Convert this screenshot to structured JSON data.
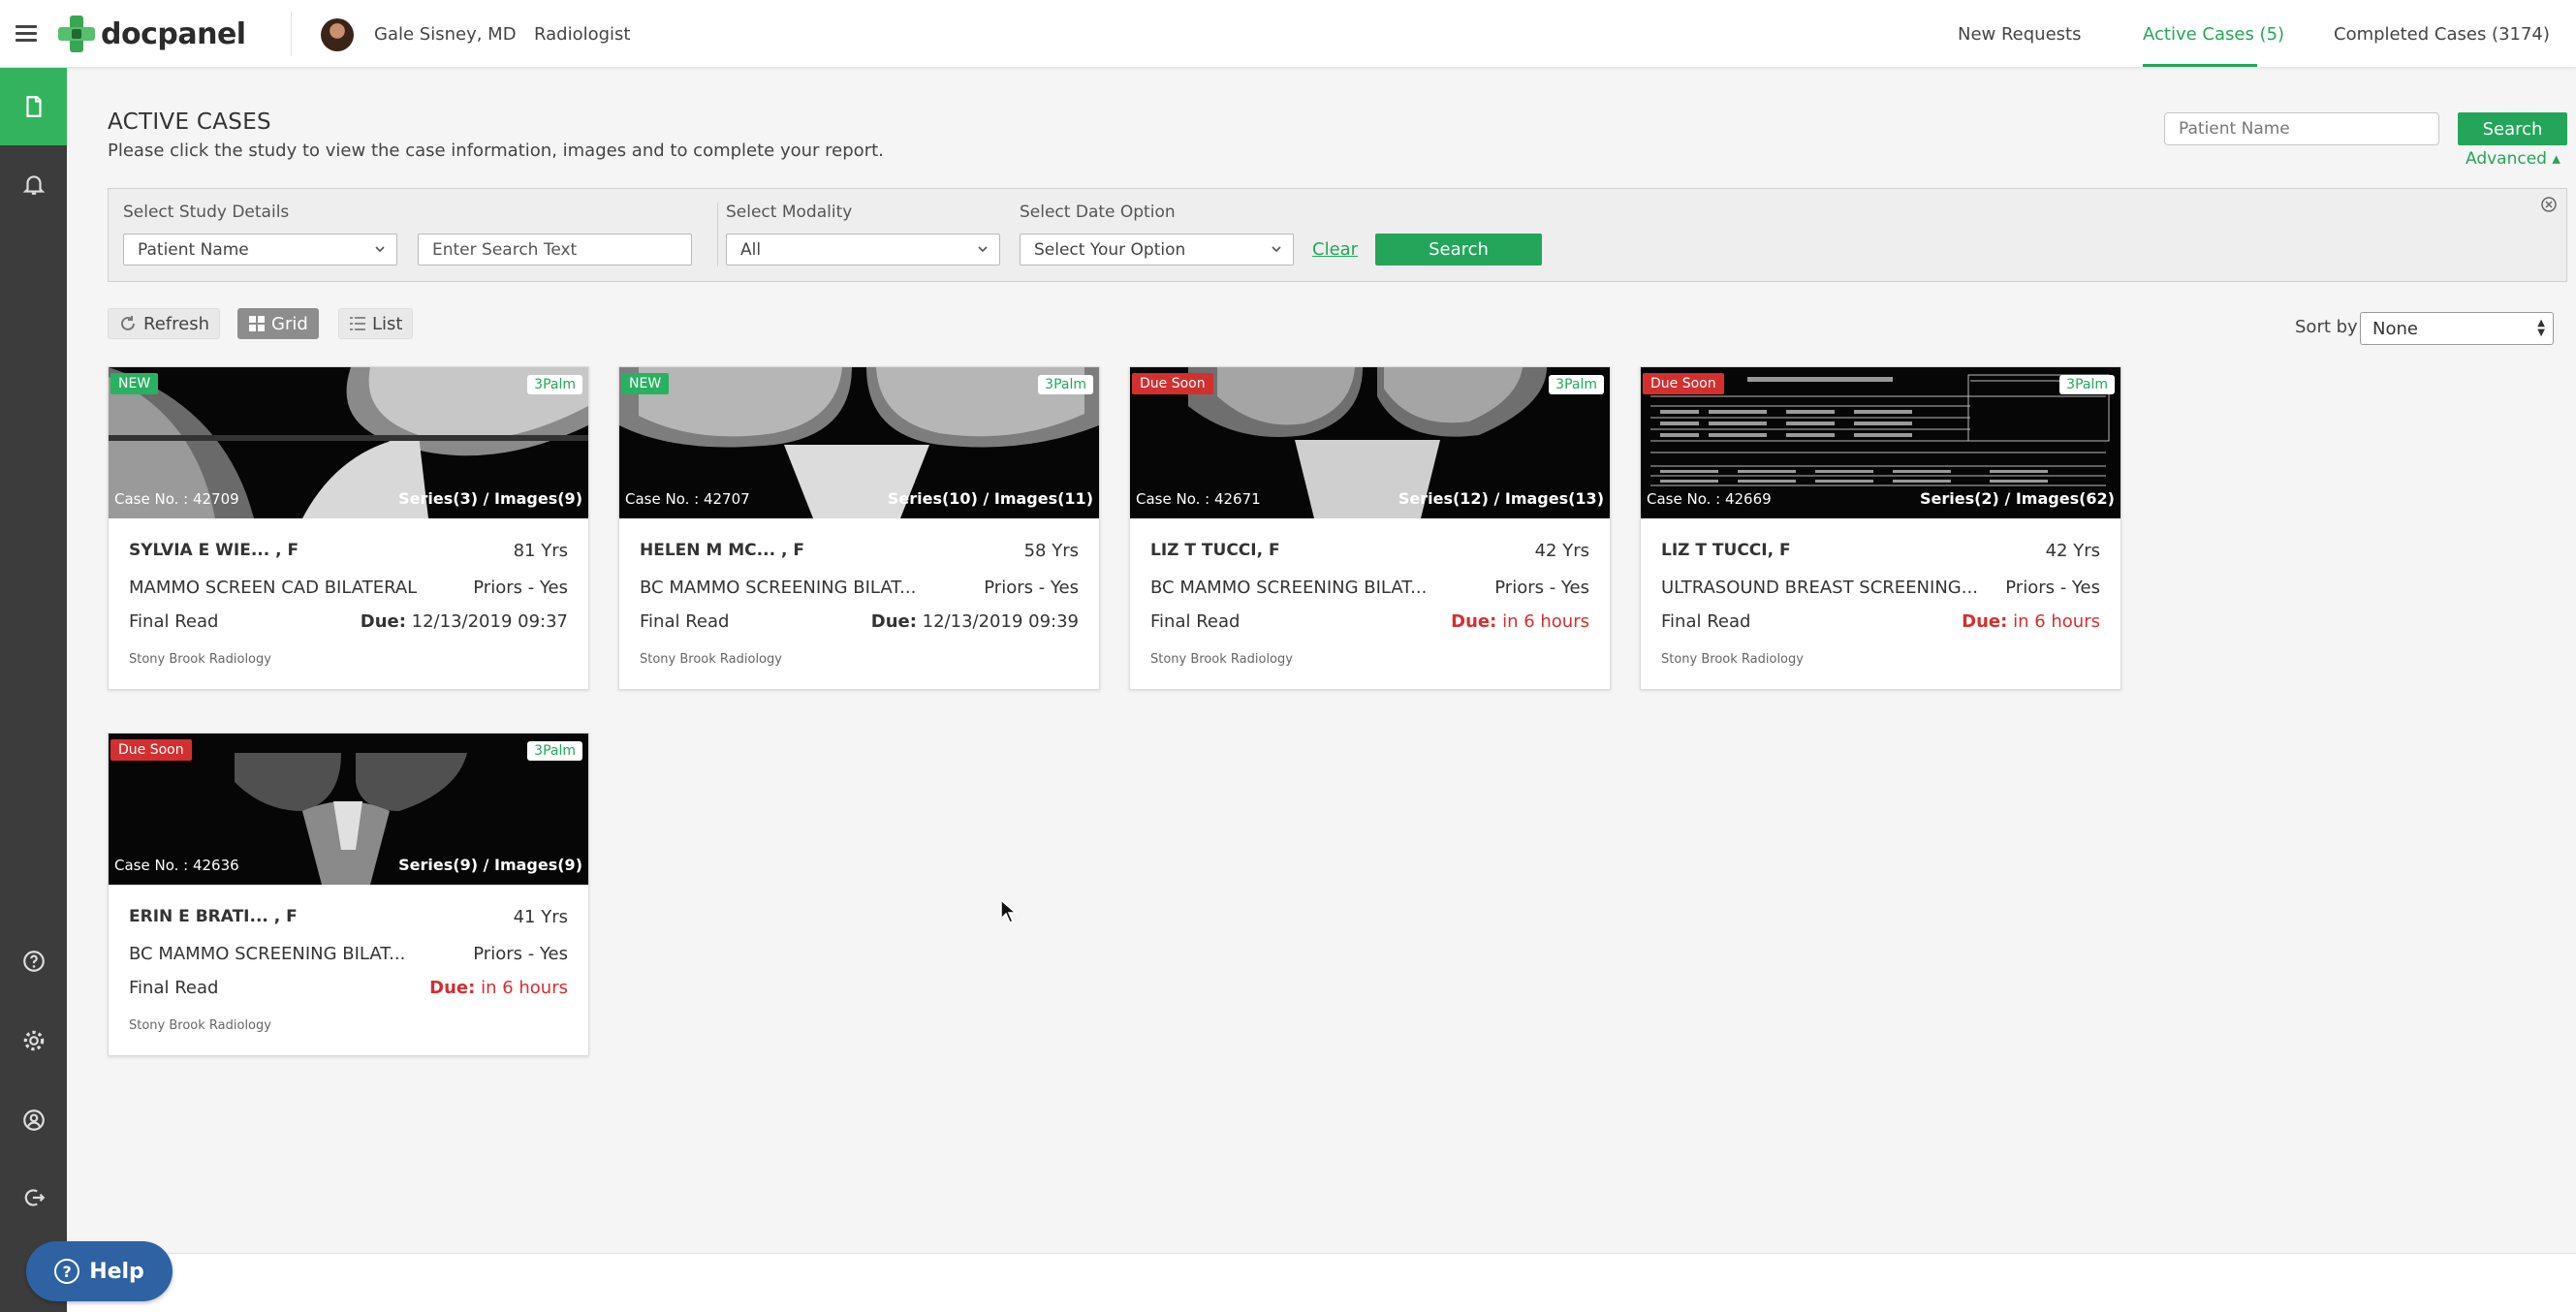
{
  "header": {
    "logo_text": "docpanel",
    "user_name": "Gale Sisney, MD",
    "user_role": "Radiologist",
    "tabs": [
      {
        "label": "New Requests",
        "active": false
      },
      {
        "label": "Active Cases (5)",
        "active": true
      },
      {
        "label": "Completed Cases (3174)",
        "active": false
      }
    ]
  },
  "sidebar": {
    "items": [
      {
        "icon": "document-icon",
        "active": true
      },
      {
        "icon": "bell-icon",
        "active": false
      },
      {
        "icon": "help-circle-icon",
        "active": false
      },
      {
        "icon": "gear-icon",
        "active": false
      },
      {
        "icon": "user-circle-icon",
        "active": false
      },
      {
        "icon": "logout-icon",
        "active": false
      }
    ]
  },
  "page": {
    "title": "ACTIVE CASES",
    "subtitle": "Please click the study to view the case information, images and to complete your report."
  },
  "quick_search": {
    "placeholder": "Patient Name",
    "button_label": "Search",
    "advanced_label": "Advanced ▴"
  },
  "filters": {
    "study_label": "Select Study Details",
    "study_value": "Patient Name",
    "text_placeholder": "Enter Search Text",
    "modality_label": "Select Modality",
    "modality_value": "All",
    "date_label": "Select Date Option",
    "date_value": "Select Your Option",
    "clear_label": "Clear",
    "search_label": "Search"
  },
  "toolbar": {
    "refresh_label": "Refresh",
    "grid_label": "Grid",
    "list_label": "List",
    "sort_label": "Sort by",
    "sort_value": "None"
  },
  "cases": [
    {
      "badge": "NEW",
      "badge_type": "new",
      "vendor": "3Palm",
      "case_no": "Case No. : 42709",
      "series": "Series(3) / Images(9)",
      "patient": "SYLVIA E WIE... ,  F",
      "age": "81 Yrs",
      "study": "MAMMO SCREEN CAD BILATERAL",
      "priors": "Priors - Yes",
      "read": "Final Read",
      "due_label": "Due:",
      "due_value": "12/13/2019 09:37",
      "due_urgent": false,
      "facility": "Stony Brook Radiology"
    },
    {
      "badge": "NEW",
      "badge_type": "new",
      "vendor": "3Palm",
      "case_no": "Case No. : 42707",
      "series": "Series(10) / Images(11)",
      "patient": "HELEN M MC... ,  F",
      "age": "58 Yrs",
      "study": "BC MAMMO SCREENING BILAT...",
      "priors": "Priors - Yes",
      "read": "Final Read",
      "due_label": "Due:",
      "due_value": "12/13/2019 09:39",
      "due_urgent": false,
      "facility": "Stony Brook Radiology"
    },
    {
      "badge": "Due Soon",
      "badge_type": "due",
      "vendor": "3Palm",
      "case_no": "Case No. : 42671",
      "series": "Series(12) / Images(13)",
      "patient": "LIZ T TUCCI,  F",
      "age": "42 Yrs",
      "study": "BC MAMMO SCREENING BILAT...",
      "priors": "Priors - Yes",
      "read": "Final Read",
      "due_label": "Due:",
      "due_value": "in 6 hours",
      "due_urgent": true,
      "facility": "Stony Brook Radiology"
    },
    {
      "badge": "Due Soon",
      "badge_type": "due",
      "vendor": "3Palm",
      "case_no": "Case No. : 42669",
      "series": "Series(2) / Images(62)",
      "patient": "LIZ T TUCCI,  F",
      "age": "42 Yrs",
      "study": "ULTRASOUND BREAST SCREENING...",
      "priors": "Priors - Yes",
      "read": "Final Read",
      "due_label": "Due:",
      "due_value": "in 6 hours",
      "due_urgent": true,
      "facility": "Stony Brook Radiology"
    },
    {
      "badge": "Due Soon",
      "badge_type": "due",
      "vendor": "3Palm",
      "case_no": "Case No. : 42636",
      "series": "Series(9) / Images(9)",
      "patient": "ERIN E BRATI... ,  F",
      "age": "41 Yrs",
      "study": "BC MAMMO SCREENING BILAT...",
      "priors": "Priors - Yes",
      "read": "Final Read",
      "due_label": "Due:",
      "due_value": "in 6 hours",
      "due_urgent": true,
      "facility": "Stony Brook Radiology"
    }
  ],
  "help": {
    "label": "Help"
  },
  "colors": {
    "accent": "#23a65a",
    "urgent": "#d32f2f",
    "sidebar": "#3c3c3c",
    "help": "#2e62a3"
  }
}
